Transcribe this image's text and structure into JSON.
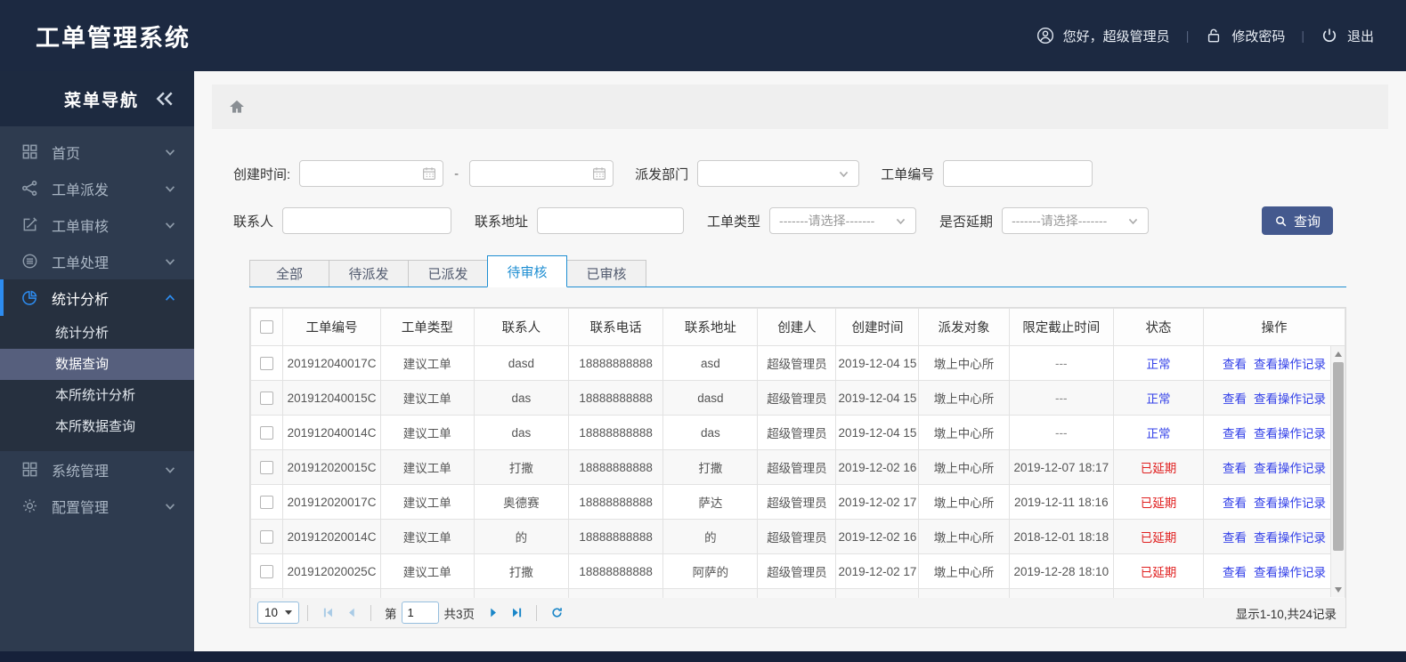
{
  "app": {
    "title": "工单管理系统"
  },
  "user_bar": {
    "greeting": "您好，超级管理员",
    "change_password": "修改密码",
    "logout": "退出",
    "divider": "|"
  },
  "sidebar": {
    "title": "菜单导航",
    "items": [
      {
        "name": "home",
        "label": "首页",
        "icon": "dashboard-icon"
      },
      {
        "name": "order-dispatch",
        "label": "工单派发",
        "icon": "share-icon"
      },
      {
        "name": "order-audit",
        "label": "工单审核",
        "icon": "edit-icon"
      },
      {
        "name": "order-process",
        "label": "工单处理",
        "icon": "process-icon"
      },
      {
        "name": "stats-analysis",
        "label": "统计分析",
        "icon": "pie-icon",
        "active": true,
        "children": [
          "统计分析",
          "数据查询",
          "本所统计分析",
          "本所数据查询"
        ],
        "selected_child": "数据查询"
      },
      {
        "name": "system-management",
        "label": "系统管理",
        "icon": "grid-icon"
      },
      {
        "name": "config-management",
        "label": "配置管理",
        "icon": "gear-icon"
      }
    ]
  },
  "filters": {
    "create_time_label": "创建时间:",
    "range_separator": "-",
    "dept_label": "派发部门",
    "order_no_label": "工单编号",
    "contact_label": "联系人",
    "address_label": "联系地址",
    "type_label": "工单类型",
    "delay_label": "是否延期",
    "select_placeholder": "-------请选择-------",
    "search_button": "查询"
  },
  "tabs": [
    {
      "label": "全部",
      "active": false
    },
    {
      "label": "待派发",
      "active": false
    },
    {
      "label": "已派发",
      "active": false
    },
    {
      "label": "待审核",
      "active": true
    },
    {
      "label": "已审核",
      "active": false
    }
  ],
  "table": {
    "columns": [
      "工单编号",
      "工单类型",
      "联系人",
      "联系电话",
      "联系地址",
      "创建人",
      "创建时间",
      "派发对象",
      "限定截止时间",
      "状态",
      "操作"
    ],
    "action_links": [
      "查看",
      "查看操作记录"
    ],
    "rows": [
      {
        "order_no": "201912040017C",
        "type": "建议工单",
        "contact": "dasd",
        "phone": "18888888888",
        "address": "asd",
        "creator": "超级管理员",
        "create_time": "2019-12-04 15",
        "target": "墩上中心所",
        "deadline": "---",
        "status": "正常",
        "delayed": false
      },
      {
        "order_no": "201912040015C",
        "type": "建议工单",
        "contact": "das",
        "phone": "18888888888",
        "address": "dasd",
        "creator": "超级管理员",
        "create_time": "2019-12-04 15",
        "target": "墩上中心所",
        "deadline": "---",
        "status": "正常",
        "delayed": false
      },
      {
        "order_no": "201912040014C",
        "type": "建议工单",
        "contact": "das",
        "phone": "18888888888",
        "address": "das",
        "creator": "超级管理员",
        "create_time": "2019-12-04 15",
        "target": "墩上中心所",
        "deadline": "---",
        "status": "正常",
        "delayed": false
      },
      {
        "order_no": "201912020015C",
        "type": "建议工单",
        "contact": "打撒",
        "phone": "18888888888",
        "address": "打撒",
        "creator": "超级管理员",
        "create_time": "2019-12-02 16",
        "target": "墩上中心所",
        "deadline": "2019-12-07 18:17",
        "status": "已延期",
        "delayed": true
      },
      {
        "order_no": "201912020017C",
        "type": "建议工单",
        "contact": "奥德赛",
        "phone": "18888888888",
        "address": "萨达",
        "creator": "超级管理员",
        "create_time": "2019-12-02 17",
        "target": "墩上中心所",
        "deadline": "2019-12-11 18:16",
        "status": "已延期",
        "delayed": true
      },
      {
        "order_no": "201912020014C",
        "type": "建议工单",
        "contact": "的",
        "phone": "18888888888",
        "address": "的",
        "creator": "超级管理员",
        "create_time": "2019-12-02 16",
        "target": "墩上中心所",
        "deadline": "2018-12-01 18:18",
        "status": "已延期",
        "delayed": true
      },
      {
        "order_no": "201912020025C",
        "type": "建议工单",
        "contact": "打撒",
        "phone": "18888888888",
        "address": "阿萨的",
        "creator": "超级管理员",
        "create_time": "2019-12-02 17",
        "target": "墩上中心所",
        "deadline": "2019-12-28 18:10",
        "status": "已延期",
        "delayed": true
      }
    ]
  },
  "pagination": {
    "page_size": "10",
    "page_prefix": "第",
    "current_page": "1",
    "total_pages": "共3页",
    "summary": "显示1-10,共24记录"
  },
  "colors": {
    "header_bg": "#1c2941",
    "sidebar_bg": "#2e3b4f",
    "accent_blue": "#2d8cf0",
    "link_blue": "#3340e8",
    "status_delayed_red": "#e01f1f",
    "query_button_blue": "#44598e"
  }
}
